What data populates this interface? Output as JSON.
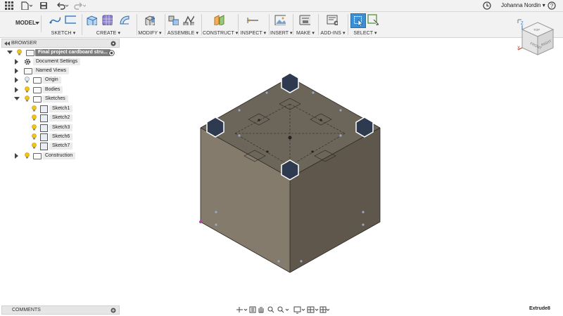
{
  "app": {
    "user_name": "Johanna Nordin",
    "workspace": "MODEL"
  },
  "toolbar": {
    "groups": [
      {
        "label": "SKETCH ▾"
      },
      {
        "label": "CREATE ▾"
      },
      {
        "label": "MODIFY ▾"
      },
      {
        "label": "ASSEMBLE ▾"
      },
      {
        "label": "CONSTRUCT ▾"
      },
      {
        "label": "INSPECT ▾"
      },
      {
        "label": "INSERT ▾"
      },
      {
        "label": "MAKE ▾"
      },
      {
        "label": "ADD-INS ▾"
      },
      {
        "label": "SELECT ▾"
      }
    ]
  },
  "browser": {
    "title": "BROWSER",
    "root": "Final project cardboard stru...",
    "items": [
      {
        "label": "Document Settings"
      },
      {
        "label": "Named Views"
      },
      {
        "label": "Origin"
      },
      {
        "label": "Bodies"
      },
      {
        "label": "Sketches"
      },
      {
        "label": "Sketch1"
      },
      {
        "label": "Sketch2"
      },
      {
        "label": "Sketch3"
      },
      {
        "label": "Sketch6"
      },
      {
        "label": "Sketch7"
      },
      {
        "label": "Construction"
      }
    ]
  },
  "comments": {
    "title": "COMMENTS"
  },
  "status": {
    "text": "Extrude8"
  },
  "viewcube": {
    "faces": [
      "FRONT",
      "RIGHT",
      "TOP"
    ]
  },
  "colors": {
    "toolbar_bg": "#f2f2f2",
    "cube_top": "#6c6559",
    "cube_left": "#827a6c",
    "cube_right": "#5e574c",
    "select_accent": "#3d8fd1"
  }
}
